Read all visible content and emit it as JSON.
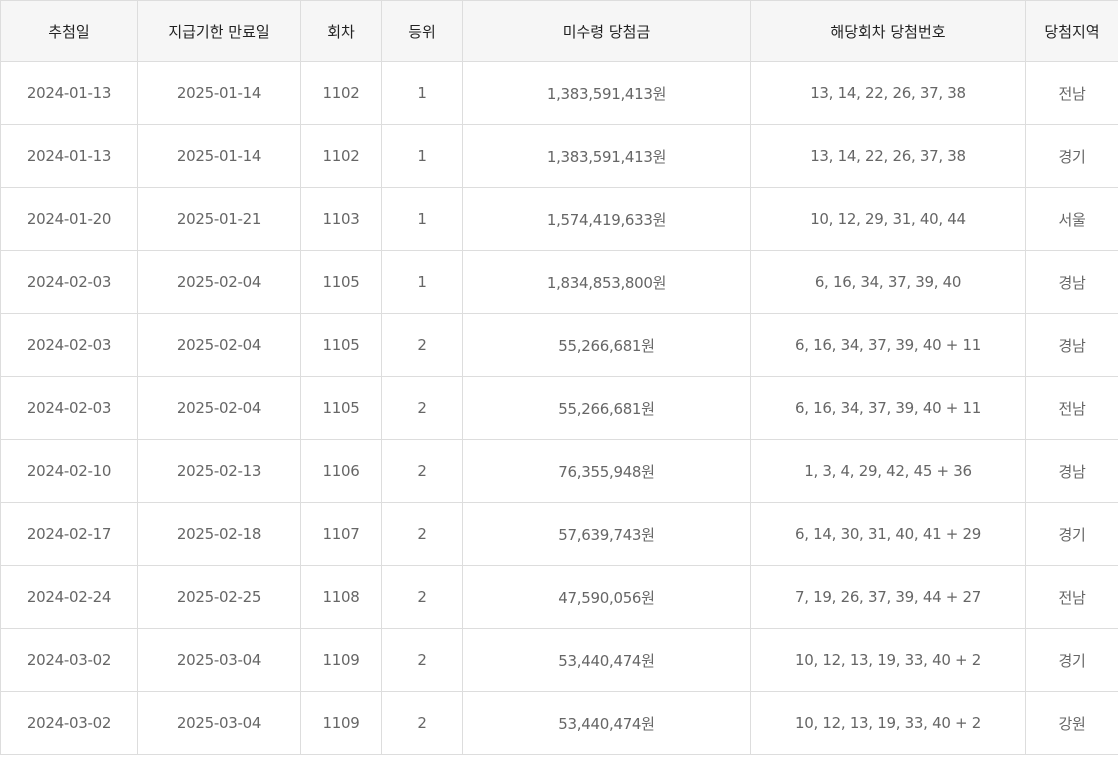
{
  "table": {
    "headers": [
      "추첨일",
      "지급기한 만료일",
      "회차",
      "등위",
      "미수령 당첨금",
      "해당회차 당첨번호",
      "당첨지역"
    ],
    "rows": [
      [
        "2024-01-13",
        "2025-01-14",
        "1102",
        "1",
        "1,383,591,413원",
        "13, 14, 22, 26, 37, 38",
        "전남"
      ],
      [
        "2024-01-13",
        "2025-01-14",
        "1102",
        "1",
        "1,383,591,413원",
        "13, 14, 22, 26, 37, 38",
        "경기"
      ],
      [
        "2024-01-20",
        "2025-01-21",
        "1103",
        "1",
        "1,574,419,633원",
        "10, 12, 29, 31, 40, 44",
        "서울"
      ],
      [
        "2024-02-03",
        "2025-02-04",
        "1105",
        "1",
        "1,834,853,800원",
        "6, 16, 34, 37, 39, 40",
        "경남"
      ],
      [
        "2024-02-03",
        "2025-02-04",
        "1105",
        "2",
        "55,266,681원",
        "6, 16, 34, 37, 39, 40 + 11",
        "경남"
      ],
      [
        "2024-02-03",
        "2025-02-04",
        "1105",
        "2",
        "55,266,681원",
        "6, 16, 34, 37, 39, 40 + 11",
        "전남"
      ],
      [
        "2024-02-10",
        "2025-02-13",
        "1106",
        "2",
        "76,355,948원",
        "1, 3, 4, 29, 42, 45 + 36",
        "경남"
      ],
      [
        "2024-02-17",
        "2025-02-18",
        "1107",
        "2",
        "57,639,743원",
        "6, 14, 30, 31, 40, 41 + 29",
        "경기"
      ],
      [
        "2024-02-24",
        "2025-02-25",
        "1108",
        "2",
        "47,590,056원",
        "7, 19, 26, 37, 39, 44 + 27",
        "전남"
      ],
      [
        "2024-03-02",
        "2025-03-04",
        "1109",
        "2",
        "53,440,474원",
        "10, 12, 13, 19, 33, 40 + 2",
        "경기"
      ],
      [
        "2024-03-02",
        "2025-03-04",
        "1109",
        "2",
        "53,440,474원",
        "10, 12, 13, 19, 33, 40 + 2",
        "강원"
      ]
    ]
  }
}
